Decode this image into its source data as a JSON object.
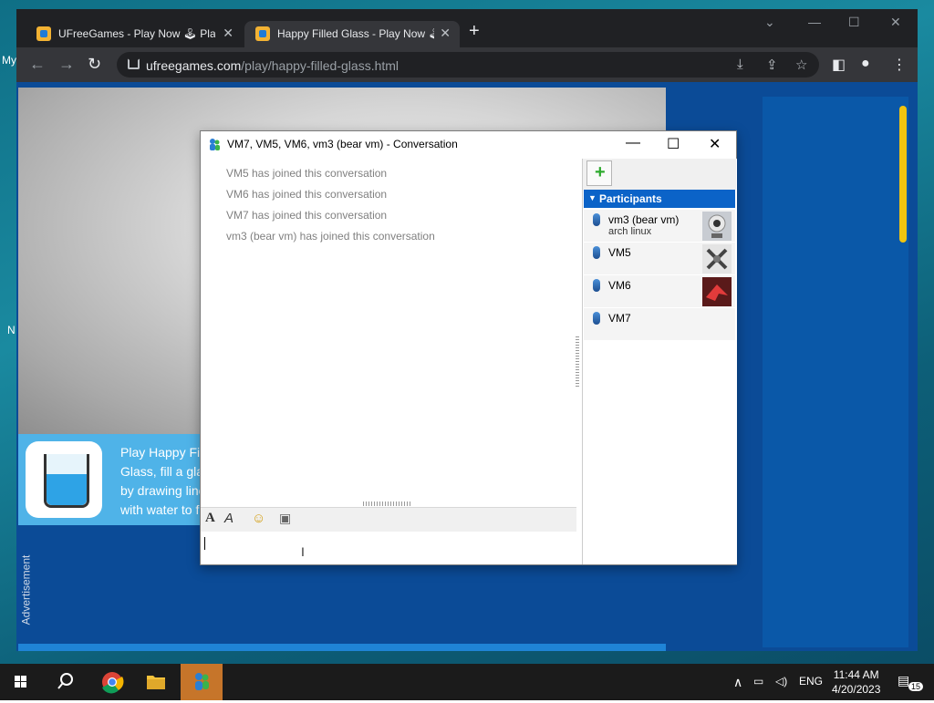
{
  "desktop": {
    "fragments": [
      "My",
      "N"
    ]
  },
  "browser": {
    "tabs": [
      {
        "title": "UFreeGames - Play Now 🕹 Play",
        "active": false
      },
      {
        "title": "Happy Filled Glass - Play Now 🕹",
        "active": true
      }
    ],
    "new_tab_symbol": "+",
    "url_host": "ufreegames.com",
    "url_path": "/play/happy-filled-glass.html",
    "icons": [
      "back-icon",
      "forward-icon",
      "reload-icon",
      "lock-icon",
      "install-icon",
      "share-icon",
      "star-icon",
      "sidepanel-icon",
      "profile-icon",
      "menu-icon"
    ]
  },
  "page": {
    "promo_text": "Play Happy Filled Glass, fill a glass by drawing lines with water to fill the glass with your pencil m",
    "ad_label": "Advertisement"
  },
  "conversation": {
    "title": "VM7, VM5, VM6, vm3 (bear vm) - Conversation",
    "messages": [
      "VM5 has joined this conversation",
      "VM6 has joined this conversation",
      "VM7 has joined this conversation",
      "vm3 (bear vm) has joined this conversation"
    ],
    "participants_header": "Participants",
    "participants": [
      {
        "name": "vm3 (bear vm)",
        "status": "arch linux",
        "avatar": "webcam-avatar"
      },
      {
        "name": "VM5",
        "status": "",
        "avatar": "tools-avatar"
      },
      {
        "name": "VM6",
        "status": "",
        "avatar": "origami-avatar"
      },
      {
        "name": "VM7",
        "status": "",
        "avatar": ""
      }
    ]
  },
  "taskbar": {
    "lang": "ENG",
    "time": "11:44 AM",
    "date": "4/20/2023",
    "notifications": "15"
  }
}
